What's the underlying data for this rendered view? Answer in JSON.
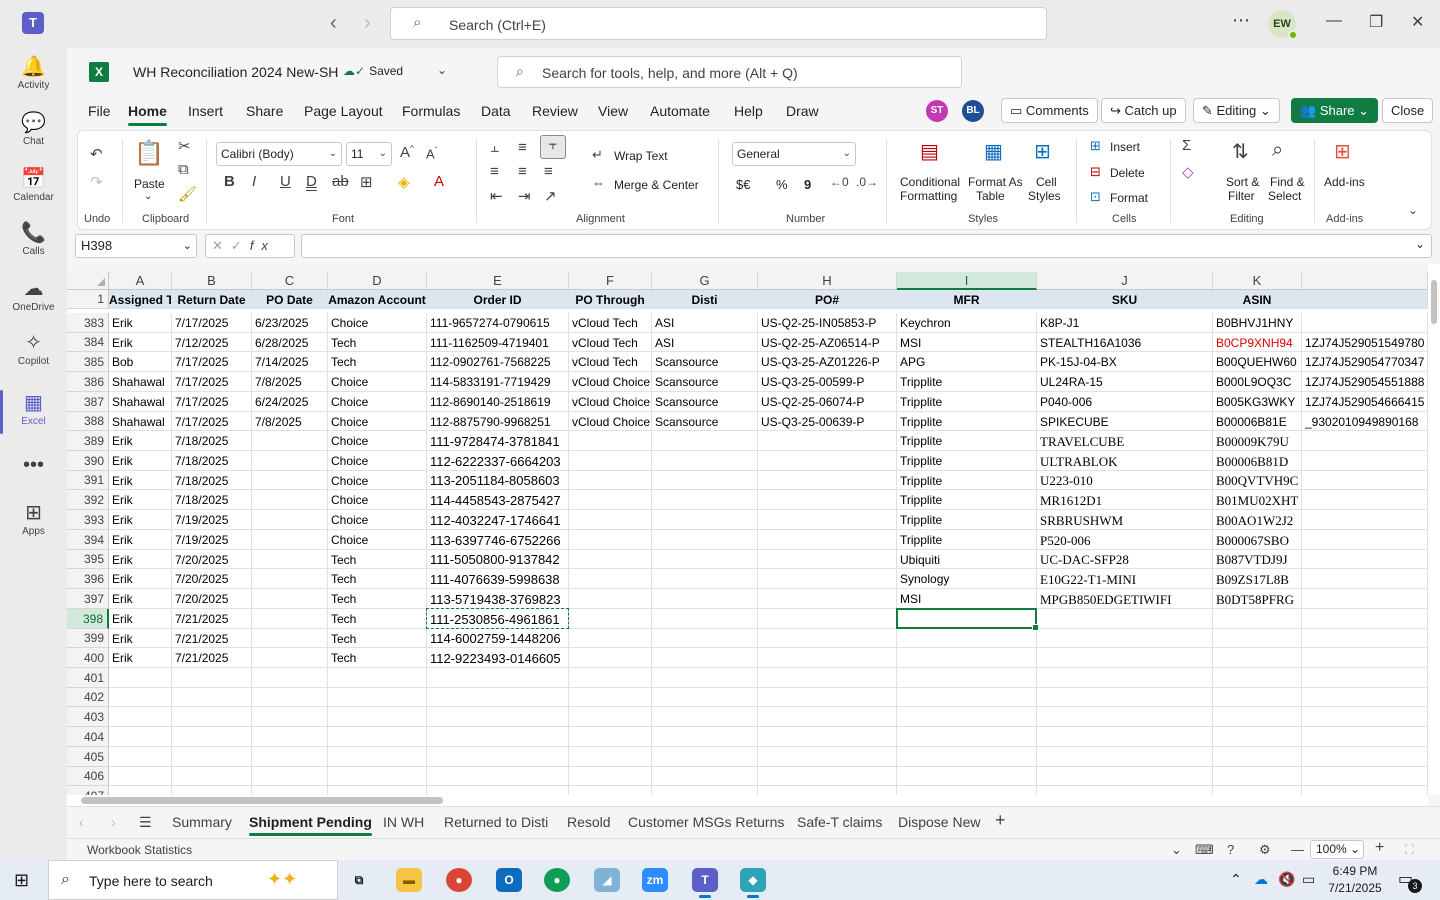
{
  "teams": {
    "search_placeholder": "Search (Ctrl+E)",
    "avatar_initials": "EW",
    "back_icon": "‹",
    "forward_icon": "›",
    "more_icon": "⋯",
    "minimize_icon": "—",
    "restore_icon": "❐",
    "close_icon": "✕",
    "rail": [
      {
        "id": "activity",
        "label": "Activity",
        "icon": "bell-icon",
        "glyph": "🔔"
      },
      {
        "id": "chat",
        "label": "Chat",
        "icon": "chat-icon",
        "glyph": "💬"
      },
      {
        "id": "calendar",
        "label": "Calendar",
        "icon": "calendar-icon",
        "glyph": "📅"
      },
      {
        "id": "calls",
        "label": "Calls",
        "icon": "phone-icon",
        "glyph": "📞"
      },
      {
        "id": "onedrive",
        "label": "OneDrive",
        "icon": "cloud-icon",
        "glyph": "☁"
      },
      {
        "id": "copilot",
        "label": "Copilot",
        "icon": "copilot-icon",
        "glyph": "✧"
      },
      {
        "id": "excel",
        "label": "Excel",
        "icon": "excel-icon",
        "glyph": "▦"
      },
      {
        "id": "more",
        "label": "",
        "icon": "more-icon",
        "glyph": "•••"
      },
      {
        "id": "apps",
        "label": "Apps",
        "icon": "apps-icon",
        "glyph": "⊞"
      }
    ]
  },
  "excel": {
    "doc_title": "WH Reconciliation 2024 New-SH",
    "saved_label": "Saved",
    "tools_search_placeholder": "Search for tools, help, and more (Alt + Q)",
    "menu_tabs": [
      "File",
      "Home",
      "Insert",
      "Share",
      "Page Layout",
      "Formulas",
      "Data",
      "Review",
      "View",
      "Automate",
      "Help",
      "Draw"
    ],
    "active_tab": "Home",
    "collaborators": [
      {
        "initials": "ST",
        "color": "#c239b3"
      },
      {
        "initials": "BL",
        "color": "#1f4e99"
      }
    ],
    "buttons": {
      "comments": "Comments",
      "catch_up": "Catch up",
      "editing": "Editing",
      "share": "Share",
      "close": "Close"
    },
    "ribbon": {
      "undo_group": "Undo",
      "clipboard": {
        "label": "Clipboard",
        "paste": "Paste"
      },
      "font": {
        "label": "Font",
        "family": "Calibri (Body)",
        "size": "11"
      },
      "alignment": {
        "label": "Alignment",
        "wrap_text": "Wrap Text",
        "merge_center": "Merge & Center"
      },
      "number": {
        "label": "Number",
        "format": "General",
        "currency": "$€",
        "percent": "%",
        "comma": "9"
      },
      "styles": {
        "label": "Styles",
        "conditional_1": "Conditional",
        "conditional_2": "Formatting",
        "format_as_1": "Format As",
        "format_as_2": "Table",
        "cell_styles_1": "Cell",
        "cell_styles_2": "Styles"
      },
      "cells": {
        "label": "Cells",
        "insert": "Insert",
        "delete": "Delete",
        "format": "Format"
      },
      "editing": {
        "label": "Editing",
        "sort_1": "Sort &",
        "sort_2": "Filter",
        "find_1": "Find &",
        "find_2": "Select"
      },
      "addins": {
        "label": "Add-ins",
        "button": "Add-ins"
      }
    },
    "name_box": "H398",
    "formula_value": "",
    "columns": [
      "A",
      "B",
      "C",
      "D",
      "E",
      "F",
      "G",
      "H",
      "I",
      "J",
      "K"
    ],
    "selected_column": "I",
    "header_row": {
      "num": "1",
      "cells": [
        "Assigned To",
        "Return Date",
        "PO Date",
        "Amazon Account",
        "Order ID",
        "PO Through",
        "Disti",
        "PO#",
        "MFR",
        "SKU",
        "ASIN",
        ""
      ]
    },
    "rows": [
      {
        "num": "383",
        "cells": [
          "Erik",
          "7/17/2025",
          "6/23/2025",
          "Choice",
          "111-9657274-0790615",
          "vCloud Tech",
          "ASI",
          "US-Q2-25-IN05853-P",
          "Keychron",
          "K8P-J1",
          "B0BHVJ1HNY",
          ""
        ]
      },
      {
        "num": "384",
        "cells": [
          "Erik",
          "7/12/2025",
          "6/28/2025",
          "Tech",
          "111-1162509-4719401",
          "vCloud Tech",
          "ASI",
          "US-Q2-25-AZ06514-P",
          "MSI",
          "STEALTH16A1036",
          "B0CP9XNH94",
          "1ZJ74J529051549780"
        ]
      },
      {
        "num": "385",
        "cells": [
          "Bob",
          "7/17/2025",
          "7/14/2025",
          "Tech",
          "112-0902761-7568225",
          "vCloud Tech",
          "Scansource",
          "US-Q3-25-AZ01226-P",
          "APG",
          "PK-15J-04-BX",
          "B00QUEHW60",
          "1ZJ74J529054770347"
        ]
      },
      {
        "num": "386",
        "cells": [
          "Shahawal",
          "7/17/2025",
          "7/8/2025",
          "Choice",
          "114-5833191-7719429",
          "vCloud Choice",
          "Scansource",
          "US-Q3-25-00599-P",
          "Tripplite",
          "UL24RA-15",
          "B000L9OQ3C",
          "1ZJ74J529054551888"
        ]
      },
      {
        "num": "387",
        "cells": [
          "Shahawal",
          "7/17/2025",
          "6/24/2025",
          "Choice",
          "112-8690140-2518619",
          "vCloud Choice",
          "Scansource",
          "US-Q2-25-06074-P",
          "Tripplite",
          "P040-006",
          "B005KG3WKY",
          "1ZJ74J529054666415"
        ]
      },
      {
        "num": "388",
        "cells": [
          "Shahawal",
          "7/17/2025",
          "7/8/2025",
          "Choice",
          "112-8875790-9968251",
          "vCloud Choice",
          "Scansource",
          "US-Q3-25-00639-P",
          "Tripplite",
          "SPIKECUBE",
          "B00006B81E",
          "_9302010949890168"
        ]
      },
      {
        "num": "389",
        "cells": [
          "Erik",
          "7/18/2025",
          "",
          "Choice",
          "111-9728474-3781841",
          "",
          "",
          "",
          "Tripplite",
          "TRAVELCUBE",
          "B00009K79U",
          ""
        ]
      },
      {
        "num": "390",
        "cells": [
          "Erik",
          "7/18/2025",
          "",
          "Choice",
          "112-6222337-6664203",
          "",
          "",
          "",
          "Tripplite",
          "ULTRABLOK",
          "B00006B81D",
          ""
        ]
      },
      {
        "num": "391",
        "cells": [
          "Erik",
          "7/18/2025",
          "",
          "Choice",
          "113-2051184-8058603",
          "",
          "",
          "",
          "Tripplite",
          "U223-010",
          "B00QVTVH9C",
          ""
        ]
      },
      {
        "num": "392",
        "cells": [
          "Erik",
          "7/18/2025",
          "",
          "Choice",
          "114-4458543-2875427",
          "",
          "",
          "",
          "Tripplite",
          "MR1612D1",
          "B01MU02XHT",
          ""
        ]
      },
      {
        "num": "393",
        "cells": [
          "Erik",
          "7/19/2025",
          "",
          "Choice",
          "112-4032247-1746641",
          "",
          "",
          "",
          "Tripplite",
          "SRBRUSHWM",
          "B00AO1W2J2",
          ""
        ]
      },
      {
        "num": "394",
        "cells": [
          "Erik",
          "7/19/2025",
          "",
          "Choice",
          "113-6397746-6752266",
          "",
          "",
          "",
          "Tripplite",
          "P520-006",
          "B000067SBO",
          ""
        ]
      },
      {
        "num": "395",
        "cells": [
          "Erik",
          "7/20/2025",
          "",
          "Tech",
          "111-5050800-9137842",
          "",
          "",
          "",
          "Ubiquiti",
          "UC-DAC-SFP28",
          "B087VTDJ9J",
          ""
        ]
      },
      {
        "num": "396",
        "cells": [
          "Erik",
          "7/20/2025",
          "",
          "Tech",
          "111-4076639-5998638",
          "",
          "",
          "",
          "Synology",
          "E10G22-T1-MINI",
          "B09ZS17L8B",
          ""
        ]
      },
      {
        "num": "397",
        "cells": [
          "Erik",
          "7/20/2025",
          "",
          "Tech",
          "113-5719438-3769823",
          "",
          "",
          "",
          "MSI",
          "MPGB850EDGETIWIFI",
          "B0DT58PFRG",
          ""
        ]
      },
      {
        "num": "398",
        "cells": [
          "Erik",
          "7/21/2025",
          "",
          "Tech",
          "111-2530856-4961861",
          "",
          "",
          "",
          "",
          "",
          "",
          ""
        ]
      },
      {
        "num": "399",
        "cells": [
          "Erik",
          "7/21/2025",
          "",
          "Tech",
          "114-6002759-1448206",
          "",
          "",
          "",
          "",
          "",
          "",
          ""
        ]
      },
      {
        "num": "400",
        "cells": [
          "Erik",
          "7/21/2025",
          "",
          "Tech",
          "112-9223493-0146605",
          "",
          "",
          "",
          "",
          "",
          "",
          ""
        ]
      },
      {
        "num": "401",
        "cells": [
          "",
          "",
          "",
          "",
          "",
          "",
          "",
          "",
          "",
          "",
          "",
          ""
        ]
      },
      {
        "num": "402",
        "cells": [
          "",
          "",
          "",
          "",
          "",
          "",
          "",
          "",
          "",
          "",
          "",
          ""
        ]
      },
      {
        "num": "403",
        "cells": [
          "",
          "",
          "",
          "",
          "",
          "",
          "",
          "",
          "",
          "",
          "",
          ""
        ]
      },
      {
        "num": "404",
        "cells": [
          "",
          "",
          "",
          "",
          "",
          "",
          "",
          "",
          "",
          "",
          "",
          ""
        ]
      },
      {
        "num": "405",
        "cells": [
          "",
          "",
          "",
          "",
          "",
          "",
          "",
          "",
          "",
          "",
          "",
          ""
        ]
      },
      {
        "num": "406",
        "cells": [
          "",
          "",
          "",
          "",
          "",
          "",
          "",
          "",
          "",
          "",
          "",
          ""
        ]
      },
      {
        "num": "407",
        "cells": [
          "",
          "",
          "",
          "",
          "",
          "",
          "",
          "",
          "",
          "",
          "",
          ""
        ]
      }
    ],
    "selected_row": "398",
    "red_text_cell": "B0CP9XNH94",
    "sheet_tabs": [
      "Summary",
      "Shipment Pending",
      "IN WH",
      "Returned to Disti",
      "Resold",
      "Customer MSGs Returns",
      "Safe-T claims",
      "Dispose New"
    ],
    "active_sheet": "Shipment Pending",
    "status_text": "Workbook Statistics",
    "zoom": "100%"
  },
  "taskbar": {
    "search_placeholder": "Type here to search",
    "time": "6:49 PM",
    "date": "7/21/2025",
    "notification_count": "3",
    "apps": [
      {
        "name": "task-view-icon",
        "glyph": "⧉",
        "color": "#e6ecf3",
        "fg": "#1a1a1a"
      },
      {
        "name": "file-explorer-icon",
        "glyph": "▬",
        "color": "#f4c542",
        "fg": "#8a5a00"
      },
      {
        "name": "chrome-icon",
        "glyph": "●",
        "color": "#db4437",
        "fg": "#fff"
      },
      {
        "name": "outlook-icon",
        "glyph": "O",
        "color": "#0f6cbd",
        "fg": "#fff"
      },
      {
        "name": "chrome-profile-icon",
        "glyph": "●",
        "color": "#0f9d58",
        "fg": "#fff"
      },
      {
        "name": "app-icon",
        "glyph": "◢",
        "color": "#7fb3d5",
        "fg": "#fff"
      },
      {
        "name": "zoom-icon",
        "glyph": "zm",
        "color": "#2d8cff",
        "fg": "#fff"
      },
      {
        "name": "teams-icon",
        "glyph": "T",
        "color": "#5b5fc7",
        "fg": "#fff"
      },
      {
        "name": "app2-icon",
        "glyph": "◆",
        "color": "#2fa4b8",
        "fg": "#fff"
      }
    ]
  }
}
